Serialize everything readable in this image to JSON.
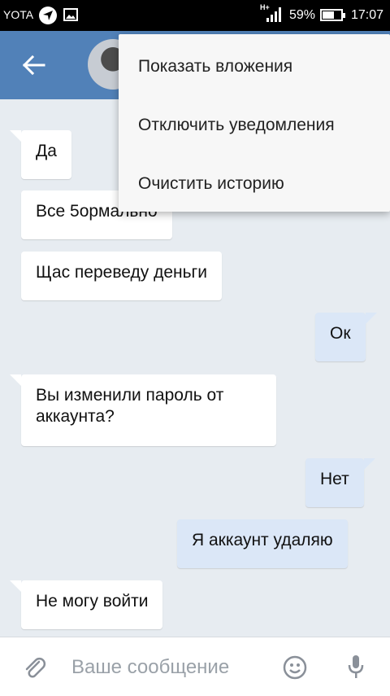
{
  "status_bar": {
    "carrier": "YOTA",
    "network": "H+",
    "battery": "59%",
    "time": "17:07"
  },
  "menu": {
    "items": [
      {
        "label": "Показать вложения"
      },
      {
        "label": "Отключить уведомления"
      },
      {
        "label": "Очистить историю"
      }
    ]
  },
  "messages": [
    {
      "text": "Да",
      "direction": "incoming"
    },
    {
      "text": "Все 5ормально",
      "direction": "incoming"
    },
    {
      "text": "Щас переведу деньги",
      "direction": "incoming"
    },
    {
      "text": "Ок",
      "direction": "outgoing"
    },
    {
      "text": "Вы изменили пароль от аккаунта?",
      "direction": "incoming"
    },
    {
      "text": "Нет",
      "direction": "outgoing"
    },
    {
      "text": "Я аккаунт удаляю",
      "direction": "outgoing"
    },
    {
      "text": "Не могу войти",
      "direction": "incoming"
    }
  ],
  "composer": {
    "placeholder": "Ваше сообщение"
  },
  "colors": {
    "toolbar": "#5181b8",
    "background": "#e7ecf1",
    "incoming": "#ffffff",
    "outgoing": "#dbe7f7"
  },
  "icons": [
    "navigation-arrow-icon",
    "image-icon",
    "signal-icon",
    "battery-icon",
    "back-arrow-icon",
    "attach-icon",
    "emoji-icon",
    "microphone-icon"
  ]
}
